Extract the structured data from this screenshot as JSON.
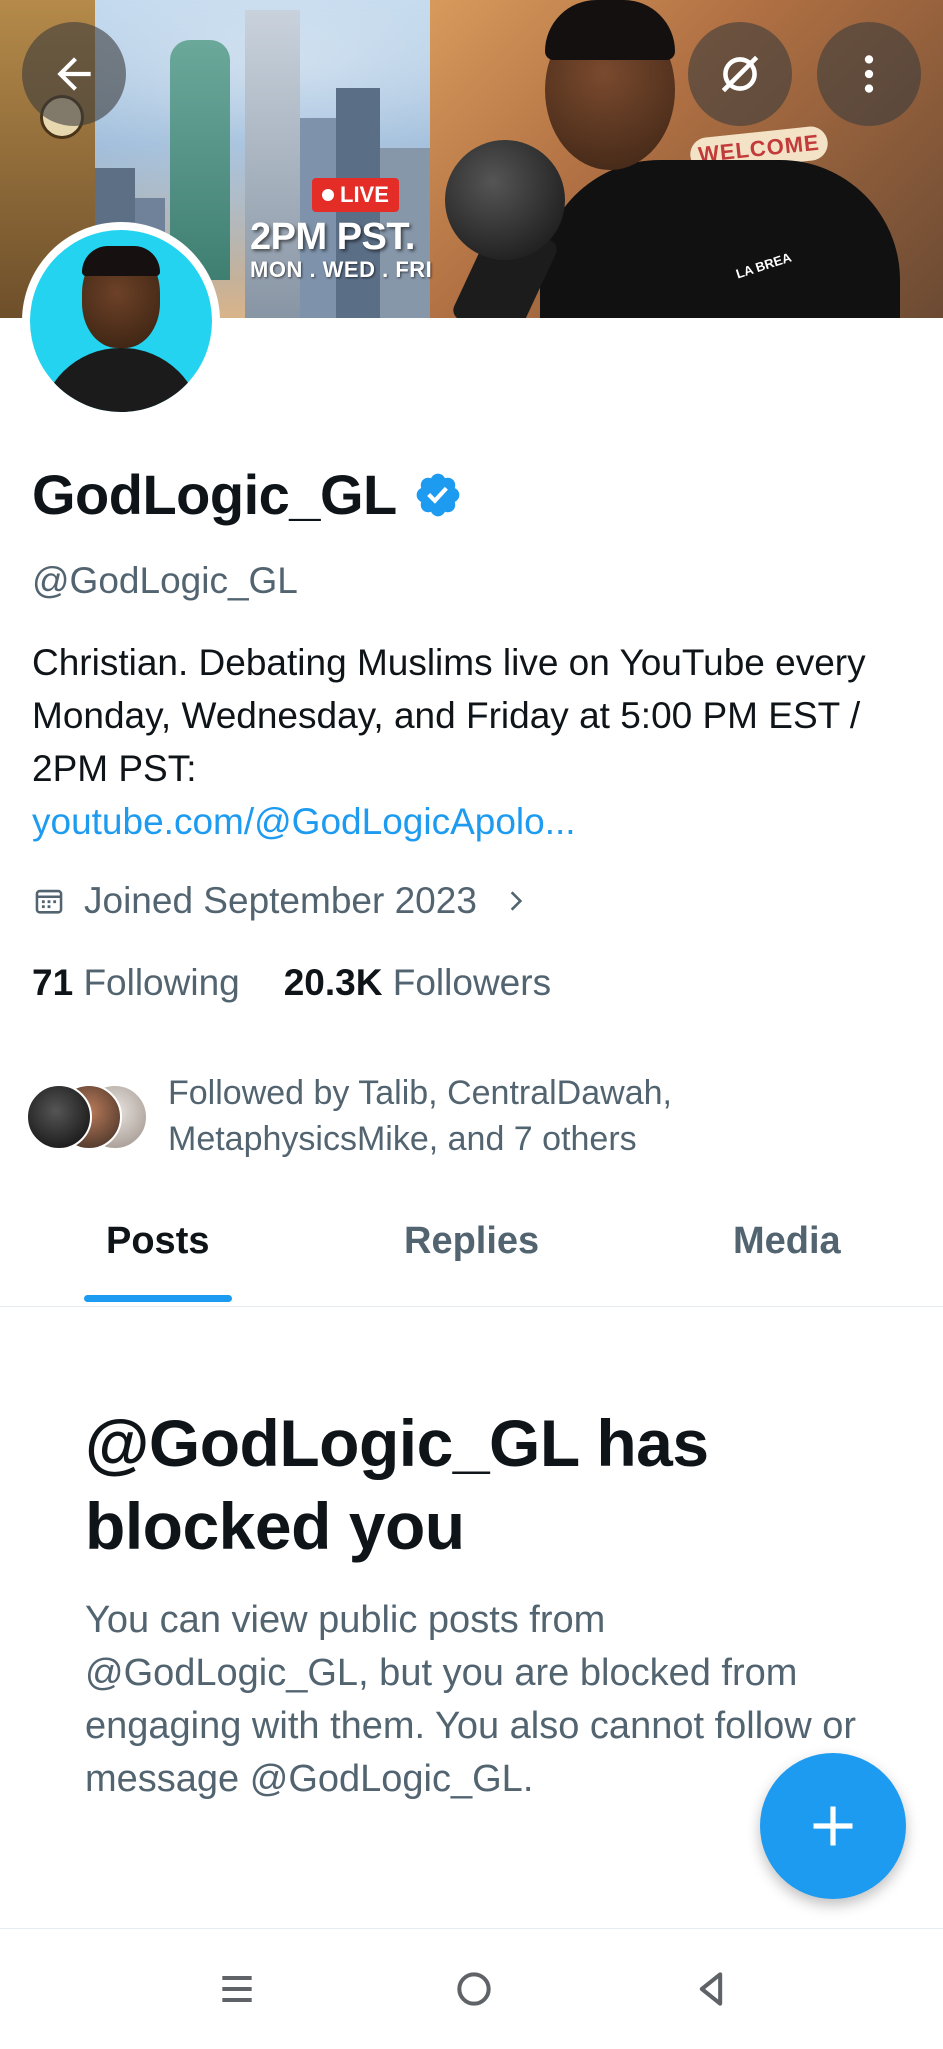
{
  "banner": {
    "live_label": "LIVE",
    "time_text": "2PM PST.",
    "days_text": "MON . WED . FRI",
    "welcome_text": "WELCOME",
    "shirt_text": "LA BREA"
  },
  "profile": {
    "name": "GodLogic_GL",
    "handle": "@GodLogic_GL",
    "bio_text": "Christian. Debating Muslims live on YouTube every Monday, Wednesday, and Friday at 5:00 PM EST / 2PM PST:",
    "bio_link": "youtube.com/@GodLogicApolo...",
    "joined": "Joined September 2023",
    "following_count": "71",
    "following_label": "Following",
    "followers_count": "20.3K",
    "followers_label": "Followers",
    "followed_by": "Followed by Talib, CentralDawah, MetaphysicsMike, and 7 others"
  },
  "tabs": [
    {
      "label": "Posts",
      "active": true
    },
    {
      "label": "Replies",
      "active": false
    },
    {
      "label": "Media",
      "active": false
    }
  ],
  "blocked": {
    "title": "@GodLogic_GL has blocked you",
    "body": "You can view public posts from @GodLogic_GL, but you are blocked from engaging with them. You also cannot follow or message @GodLogic_GL."
  },
  "icons": {
    "back": "arrow-left-icon",
    "translate_off": "no-translate-icon",
    "more": "more-vertical-icon",
    "calendar": "calendar-icon",
    "verified": "verified-badge-icon",
    "compose": "plus-icon",
    "nav_recents": "recents-icon",
    "nav_home": "home-circle-icon",
    "nav_back": "back-triangle-icon"
  },
  "colors": {
    "accent": "#1d9bf0",
    "text_primary": "#0f1419",
    "text_secondary": "#536471",
    "live_red": "#e52d27",
    "avatar_bg": "#23d3ef"
  }
}
